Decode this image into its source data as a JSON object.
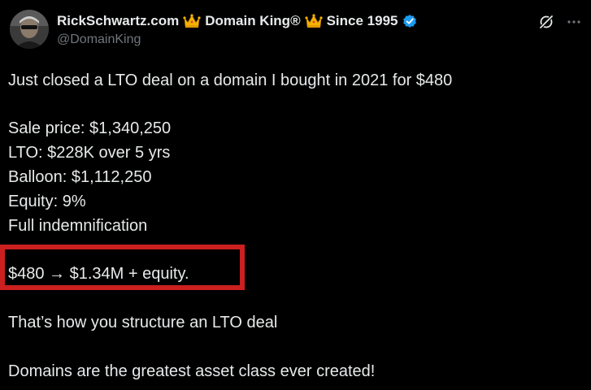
{
  "author": {
    "name_part1": "RickSchwartz.com",
    "name_part2": "Domain King®",
    "name_part3": "Since 1995",
    "handle": "@DomainKing",
    "verified": true
  },
  "tweet": {
    "intro": "Just closed a LTO deal on a domain I bought in 2021 for $480",
    "details": [
      "Sale price: $1,340,250",
      "LTO: $228K over 5 yrs",
      "Balloon: $1,112,250",
      "Equity: 9%",
      "Full indemnification"
    ],
    "highlight": "$480 → $1.34M + equity.",
    "closing_1": "That’s how you structure an LTO deal",
    "closing_2": "Domains are the greatest asset class ever created!"
  },
  "colors": {
    "background": "#000000",
    "text": "#e7e9ea",
    "secondary_text": "#71767b",
    "verified_badge": "#1d9bf0",
    "highlight_border": "#cc1f1f",
    "crown": "#f4b400"
  },
  "icons": {
    "crown": "crown-emoji-icon",
    "verified": "verified-badge-icon",
    "grok": "grok-icon",
    "more": "more-options-icon"
  }
}
